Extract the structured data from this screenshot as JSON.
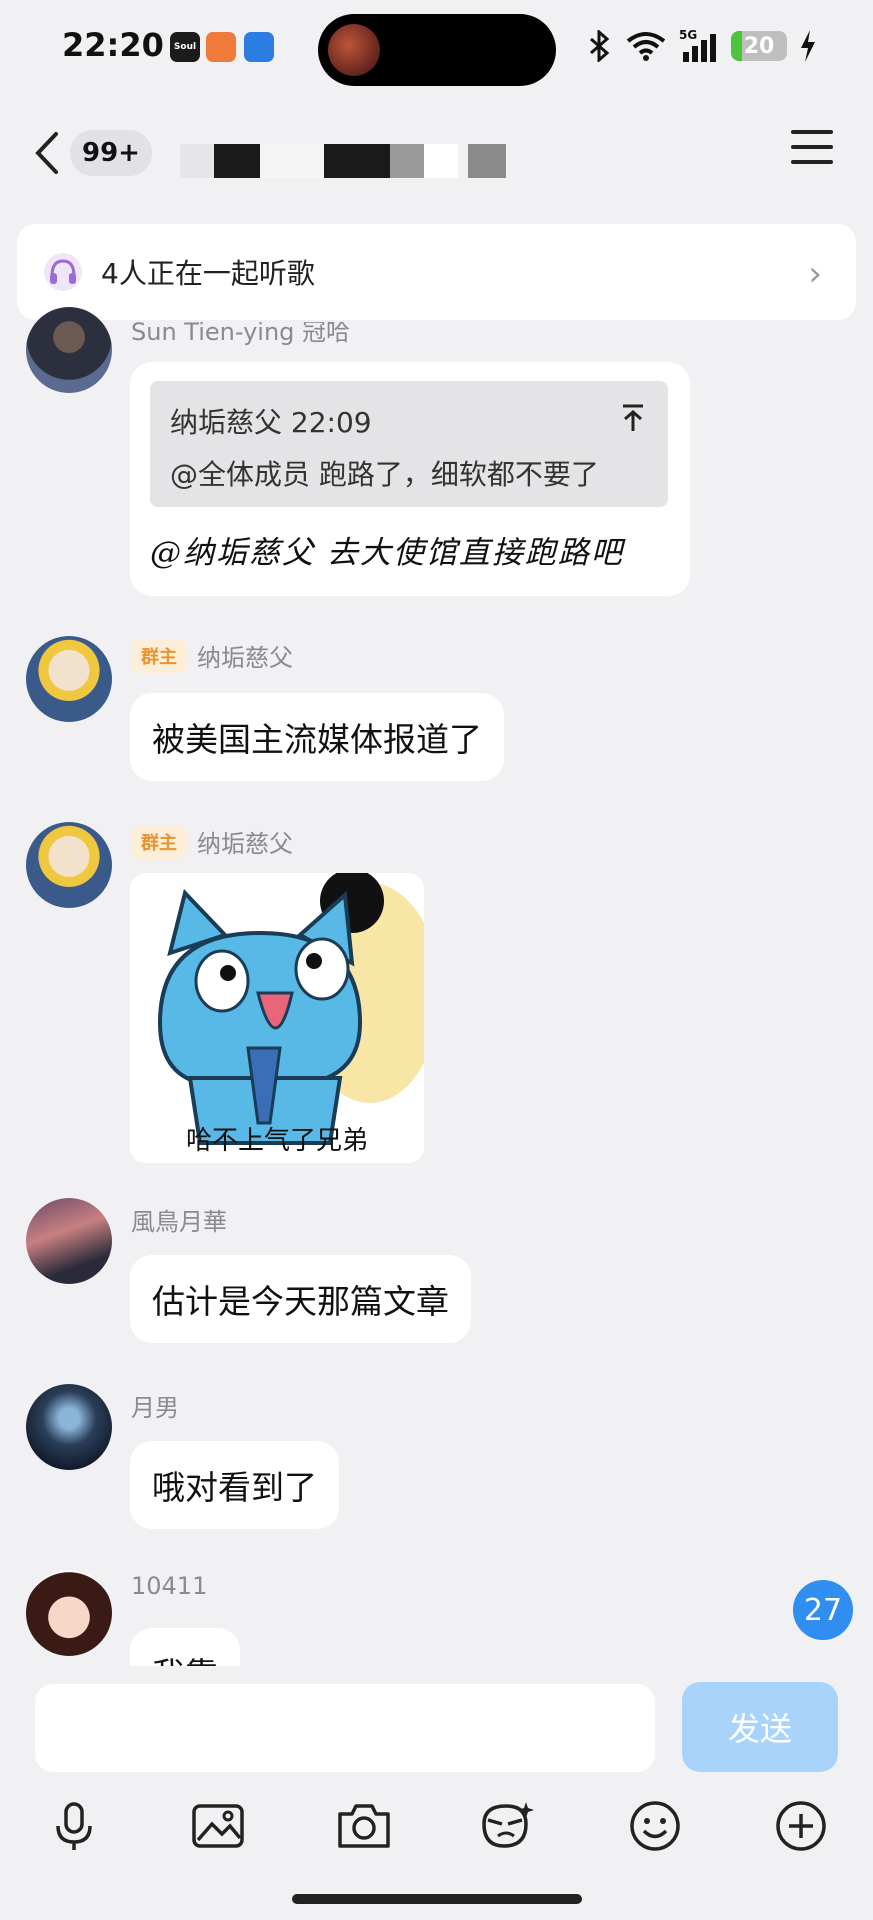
{
  "status_bar": {
    "time": "22:20",
    "app_icons": [
      {
        "name": "Soul",
        "color": "#1b1b1b"
      },
      {
        "name": "",
        "color": "#f07a3a"
      },
      {
        "name": "",
        "color": "#2a7de1"
      }
    ],
    "battery": "20",
    "battery_percent": 20,
    "network": "5G"
  },
  "nav": {
    "back_icon": "chevron-left-icon",
    "unread_count": "99+",
    "title": "",
    "menu_icon": "hamburger-menu-icon"
  },
  "listen_banner": {
    "text": "4人正在一起听歌",
    "icon": "headphones-icon"
  },
  "messages": [
    {
      "sender": "Sun Tien-ying 冠哈",
      "quote": {
        "author_time": "纳垢慈父 22:09",
        "text": "@全体成员 跑路了，细软都不要了"
      },
      "text": "@纳垢慈父 去大使馆直接跑路吧"
    },
    {
      "badge": "群主",
      "sender": "纳垢慈父",
      "text": "被美国主流媒体报道了"
    },
    {
      "badge": "群主",
      "sender": "纳垢慈父",
      "sticker_caption": "哈不上气了兄弟"
    },
    {
      "sender": "風鳥月華",
      "text": "估计是今天那篇文章"
    },
    {
      "sender": "月男",
      "text": "哦对看到了"
    },
    {
      "sender": "10411",
      "text": "我靠"
    }
  ],
  "unread_float": "27",
  "input": {
    "placeholder": "",
    "send_label": "发送"
  },
  "toolbar": [
    "microphone-icon",
    "image-icon",
    "camera-icon",
    "sticker-icon",
    "emoji-icon",
    "plus-icon"
  ],
  "colors": {
    "background": "#f1f1f4",
    "bubble": "#ffffff",
    "send_button": "#a8d4fb",
    "badge_text": "#e8932f",
    "accent_blue": "#2f8ef0"
  }
}
